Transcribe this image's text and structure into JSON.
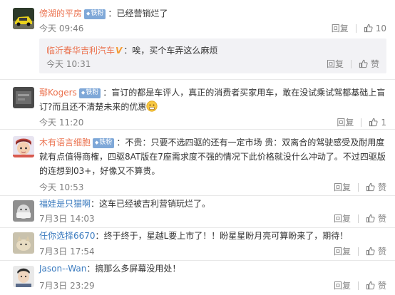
{
  "comments": [
    {
      "user": "傍湖的平房",
      "badge": "铁粉",
      "sep": "：",
      "text": "已经营销烂了",
      "time": "今天 09:46",
      "reply": "回复",
      "likes": "10",
      "sub": {
        "user": "临沂春华吉利汽车",
        "vtag": "V",
        "sep": "：",
        "text": "唉，买个车弄这么麻烦",
        "time": "今天 10:31",
        "reply": "回复",
        "likes": "赞"
      }
    },
    {
      "user": "鄢Kogers",
      "badge": "铁粉",
      "sep": "：",
      "text": "盲订的都是车评人，真正的消费者买家用车，敢在没试乘试驾都基础上盲订?而且还不清楚未来的优惠",
      "time": "今天 11:20",
      "reply": "回复",
      "likes": "1"
    },
    {
      "user": "木有语言细胞",
      "badge": "铁粉",
      "sep": "：",
      "text": "不贵：只要不选四驱的还有一定市场 贵：双离合的驾驶感受及耐用度就有点值得商榷，四驱8AT版在7座需求度不强的情况下此价格就没什么冲动了。不过四驱版的连想到03+，好像又不算贵。",
      "time": "今天 10:53",
      "reply": "回复",
      "likes": "赞"
    },
    {
      "user": "福娃是只猫啊",
      "badge": "",
      "sep": "：",
      "text": "这车已经被吉利营销玩烂了。",
      "time": "7月3日 14:03",
      "reply": "回复",
      "likes": "赞"
    },
    {
      "user": "任你选择6670",
      "badge": "",
      "sep": "：",
      "text": "终于终于，星越L要上市了！！盼星星盼月亮可算盼来了，期待！",
      "time": "7月3日 17:54",
      "reply": "回复",
      "likes": "赞"
    },
    {
      "user": "Jason--Wan",
      "badge": "",
      "sep": "：",
      "text": "搞那么多屏幕没用处！",
      "time": "7月3日 23:29",
      "reply": "回复",
      "likes": "赞"
    }
  ],
  "icons": {
    "like": "thumbs-up-icon",
    "emoji": "grimace-emoji-icon"
  },
  "colors": {
    "username_orange": "#eb7350",
    "username_blue": "#3b7bbf",
    "badge": "#7fa8d8",
    "meta_gray": "#808080"
  }
}
